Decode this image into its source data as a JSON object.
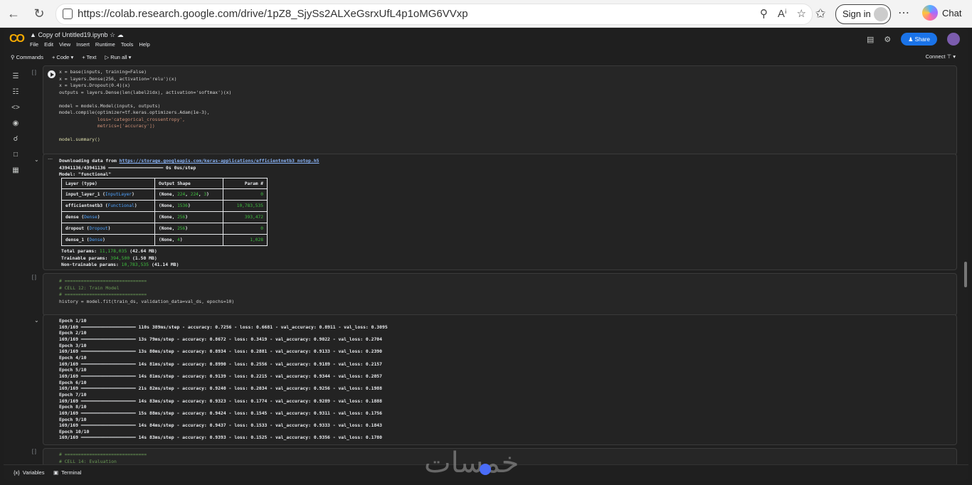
{
  "browser": {
    "url": "https://colab.research.google.com/drive/1pZ8_SjySs2ALXeGsrxUfL4p1oMG6VVxp",
    "signin_label": "Sign in",
    "chat_label": "Chat"
  },
  "colab": {
    "title": "Copy of Untitled19.ipynb",
    "menu": [
      "File",
      "Edit",
      "View",
      "Insert",
      "Runtime",
      "Tools",
      "Help"
    ],
    "share_label": "Share",
    "toolbar": {
      "commands": "Commands",
      "code": "+ Code",
      "text": "+ Text",
      "run_all": "Run all",
      "connect": "Connect"
    },
    "bottom": {
      "variables": "Variables",
      "terminal": "Terminal"
    }
  },
  "cells": {
    "cell1_code": [
      "x = base(inputs, training=False)",
      "x = layers.Dense(256, activation='relu')(x)",
      "x = layers.Dropout(0.4)(x)",
      "outputs = layers.Dense(len(label2idx), activation='softmax')(x)",
      "",
      "model = models.Model(inputs, outputs)",
      "model.compile(optimizer=tf.keras.optimizers.Adam(1e-3),",
      "              loss='categorical_crossentropy',",
      "              metrics=['accuracy'])",
      "",
      "model.summary()"
    ],
    "cell1_output": {
      "download_prefix": "Downloading data from ",
      "download_url": "https://storage.googleapis.com/keras-applications/efficientnetb3_notop.h5",
      "progress_line": "43941136/43941136 ━━━━━━━━━━━━━━━━━━━━ 0s 0us/step",
      "model_line": "Model: \"functional\"",
      "table_headers": [
        "Layer (type)",
        "Output Shape",
        "Param #"
      ],
      "table_rows": [
        {
          "name": "input_layer_1",
          "type": "InputLayer",
          "shape_a": "(None, ",
          "shape_b": "224",
          "shape_c": ", ",
          "shape_d": "224",
          "shape_e": ", ",
          "shape_f": "3",
          "shape_g": ")",
          "params": "0"
        },
        {
          "name": "efficientnetb3",
          "type": "Functional",
          "shape_a": "(None, ",
          "shape_b": "1536",
          "shape_c": ")",
          "shape_d": "",
          "shape_e": "",
          "shape_f": "",
          "shape_g": "",
          "params": "10,783,535"
        },
        {
          "name": "dense",
          "type": "Dense",
          "shape_a": "(None, ",
          "shape_b": "256",
          "shape_c": ")",
          "shape_d": "",
          "shape_e": "",
          "shape_f": "",
          "shape_g": "",
          "params": "393,472"
        },
        {
          "name": "dropout",
          "type": "Dropout",
          "shape_a": "(None, ",
          "shape_b": "256",
          "shape_c": ")",
          "shape_d": "",
          "shape_e": "",
          "shape_f": "",
          "shape_g": "",
          "params": "0"
        },
        {
          "name": "dense_1",
          "type": "Dense",
          "shape_a": "(None, ",
          "shape_b": "4",
          "shape_c": ")",
          "shape_d": "",
          "shape_e": "",
          "shape_f": "",
          "shape_g": "",
          "params": "1,028"
        }
      ],
      "totals": [
        {
          "label": "Total params: ",
          "value": "11,178,035",
          "suffix": " (42.64 MB)"
        },
        {
          "label": "Trainable params: ",
          "value": "394,500",
          "suffix": " (1.50 MB)"
        },
        {
          "label": "Non-trainable params: ",
          "value": "10,783,535",
          "suffix": " (41.14 MB)"
        }
      ]
    },
    "cell2_code": [
      "# ==============================",
      "# CELL 12: Train Model",
      "# ==============================",
      "history = model.fit(train_ds, validation_data=val_ds, epochs=10)"
    ],
    "cell2_output": [
      "Epoch 1/10",
      "169/169 ━━━━━━━━━━━━━━━━━━━━ 110s 389ms/step - accuracy: 0.7256 - loss: 0.6681 - val_accuracy: 0.8911 - val_loss: 0.3095",
      "Epoch 2/10",
      "169/169 ━━━━━━━━━━━━━━━━━━━━ 13s 79ms/step - accuracy: 0.8672 - loss: 0.3419 - val_accuracy: 0.9022 - val_loss: 0.2704",
      "Epoch 3/10",
      "169/169 ━━━━━━━━━━━━━━━━━━━━ 13s 80ms/step - accuracy: 0.8934 - loss: 0.2881 - val_accuracy: 0.9133 - val_loss: 0.2390",
      "Epoch 4/10",
      "169/169 ━━━━━━━━━━━━━━━━━━━━ 14s 81ms/step - accuracy: 0.8990 - loss: 0.2556 - val_accuracy: 0.9189 - val_loss: 0.2157",
      "Epoch 5/10",
      "169/169 ━━━━━━━━━━━━━━━━━━━━ 14s 81ms/step - accuracy: 0.9139 - loss: 0.2215 - val_accuracy: 0.9344 - val_loss: 0.2057",
      "Epoch 6/10",
      "169/169 ━━━━━━━━━━━━━━━━━━━━ 21s 82ms/step - accuracy: 0.9240 - loss: 0.2034 - val_accuracy: 0.9256 - val_loss: 0.1988",
      "Epoch 7/10",
      "169/169 ━━━━━━━━━━━━━━━━━━━━ 14s 83ms/step - accuracy: 0.9323 - loss: 0.1774 - val_accuracy: 0.9289 - val_loss: 0.1888",
      "Epoch 8/10",
      "169/169 ━━━━━━━━━━━━━━━━━━━━ 15s 88ms/step - accuracy: 0.9424 - loss: 0.1545 - val_accuracy: 0.9311 - val_loss: 0.1756",
      "Epoch 9/10",
      "169/169 ━━━━━━━━━━━━━━━━━━━━ 14s 84ms/step - accuracy: 0.9437 - loss: 0.1533 - val_accuracy: 0.9333 - val_loss: 0.1843",
      "Epoch 10/10",
      "169/169 ━━━━━━━━━━━━━━━━━━━━ 14s 83ms/step - accuracy: 0.9393 - loss: 0.1525 - val_accuracy: 0.9356 - val_loss: 0.1780"
    ],
    "cell3_code": [
      "# ==============================",
      "# CELL 14: Evaluation"
    ]
  },
  "watermark": "خمسات"
}
